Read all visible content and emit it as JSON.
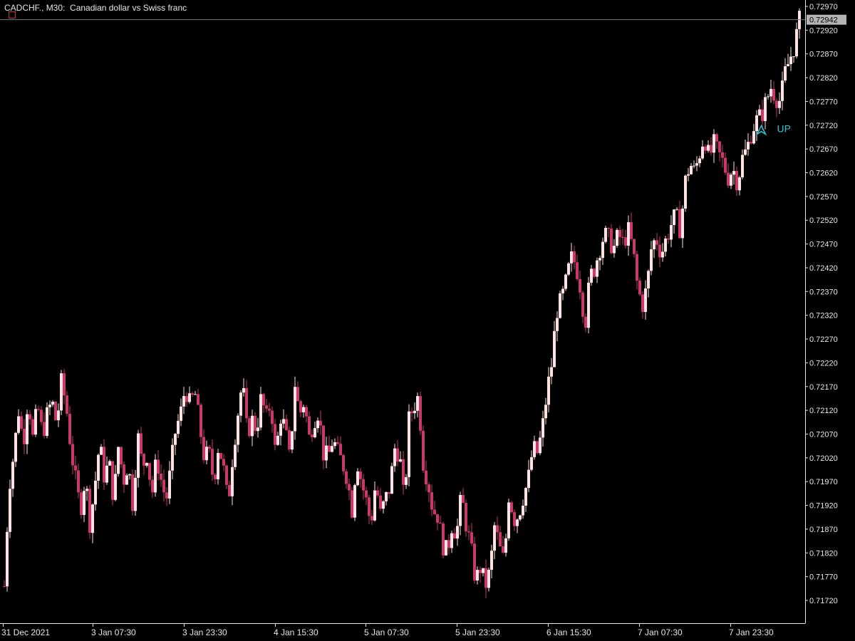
{
  "header": {
    "symbol": "CADCHF.",
    "timeframe": "M30",
    "description": "Canadian dollar vs Swiss franc"
  },
  "colors": {
    "background": "#000000",
    "axis": "#e6e6e6",
    "bull_candle": "#ffe2e2",
    "bear_candle": "#c8386a",
    "signal": "#2ec8d8",
    "price_line": "#7a7a7a",
    "price_tag": "#b4b4b4"
  },
  "chart_data": {
    "type": "candlestick",
    "ylim": [
      0.71695,
      0.7299
    ],
    "y_ticks": [
      "0.72970",
      "0.72920",
      "0.72870",
      "0.72820",
      "0.72770",
      "0.72720",
      "0.72670",
      "0.72620",
      "0.72570",
      "0.72520",
      "0.72470",
      "0.72420",
      "0.72370",
      "0.72320",
      "0.72270",
      "0.72220",
      "0.72170",
      "0.72120",
      "0.72070",
      "0.72020",
      "0.71970",
      "0.71920",
      "0.71870",
      "0.71820",
      "0.71770",
      "0.71720"
    ],
    "x_ticks": [
      "31 Dec 2021",
      "3 Jan 07:30",
      "3 Jan 23:30",
      "4 Jan 15:30",
      "5 Jan 07:30",
      "5 Jan 23:30",
      "6 Jan 15:30",
      "7 Jan 07:30",
      "7 Jan 23:30"
    ],
    "current_price": "0.72942",
    "close_path": [
      0.7175,
      0.7196,
      0.7203,
      0.7212,
      0.7205,
      0.7215,
      0.7206,
      0.7213,
      0.7207,
      0.7211,
      0.7214,
      0.7209,
      0.7218,
      0.7213,
      0.7204,
      0.7197,
      0.7191,
      0.7198,
      0.7188,
      0.7196,
      0.7205,
      0.7198,
      0.7201,
      0.7193,
      0.7205,
      0.7197,
      0.7201,
      0.7192,
      0.7207,
      0.72,
      0.7203,
      0.7194,
      0.7202,
      0.7197,
      0.7193,
      0.72,
      0.7208,
      0.7211,
      0.7217,
      0.7213,
      0.7216,
      0.7209,
      0.7202,
      0.7203,
      0.7197,
      0.7205,
      0.72,
      0.7192,
      0.7203,
      0.7211,
      0.7218,
      0.7207,
      0.721,
      0.7208,
      0.7215,
      0.721,
      0.7214,
      0.7202,
      0.7211,
      0.7208,
      0.7201,
      0.7218,
      0.7211,
      0.7214,
      0.7206,
      0.721,
      0.7212,
      0.7203,
      0.7202,
      0.7206,
      0.7203,
      0.7201,
      0.7198,
      0.7191,
      0.7202,
      0.7197,
      0.7193,
      0.7188,
      0.7197,
      0.719,
      0.7193,
      0.7196,
      0.7204,
      0.7203,
      0.7192,
      0.721,
      0.7213,
      0.7215,
      0.7201,
      0.7197,
      0.7191,
      0.719,
      0.7184,
      0.7182,
      0.7188,
      0.7186,
      0.7194,
      0.7188,
      0.7183,
      0.7176,
      0.7179,
      0.7175,
      0.7178,
      0.7188,
      0.7183,
      0.718,
      0.7195,
      0.7189,
      0.719,
      0.7194,
      0.7197,
      0.7204,
      0.7203,
      0.7208,
      0.7216,
      0.7222,
      0.7233,
      0.7235,
      0.7239,
      0.7244,
      0.7243,
      0.7238,
      0.723,
      0.724,
      0.7242,
      0.7246,
      0.7249,
      0.7248,
      0.7246,
      0.7249,
      0.7247,
      0.725,
      0.7246,
      0.7238,
      0.7234,
      0.7238,
      0.7247,
      0.7248,
      0.7245,
      0.7248,
      0.7251,
      0.7253,
      0.725,
      0.726,
      0.7264,
      0.7262,
      0.7266,
      0.727,
      0.7265,
      0.7268,
      0.7266,
      0.7264,
      0.7261,
      0.7263,
      0.726,
      0.7265,
      0.7267,
      0.7271,
      0.7273,
      0.7274,
      0.7277,
      0.728,
      0.7278,
      0.7277,
      0.7283,
      0.7286,
      0.7289,
      0.7294
    ],
    "signals": [
      {
        "label": "UP",
        "direction": "up",
        "price": 0.7271,
        "bar_index": 159
      }
    ]
  }
}
